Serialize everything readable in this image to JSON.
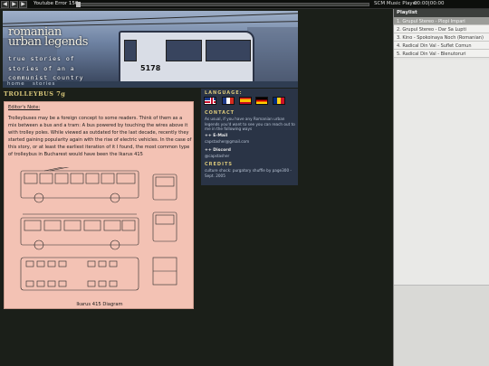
{
  "player": {
    "prev_icon": "◀",
    "play_icon": "▶",
    "next_icon": "▶",
    "status": "Youtube Error 150",
    "app_name": "SCM Music Player",
    "time": "00:00|00:00"
  },
  "header": {
    "title_line1": "romanian",
    "title_line2": "urban legends",
    "tagline": "true stories of\nstories of an a\ncommunist country",
    "bus_number": "5178",
    "nav": {
      "home": "home",
      "stories": "stories"
    }
  },
  "article": {
    "title": "TROLLEYBUS 7g",
    "editor_note": "Editor's Note:",
    "body": "Trolleybuses may be a foreign concept to some readers. Think of them as a mix between a bus and a tram: A bus powered by touching the wires above it with trolley poles. While viewed as outdated for the last decade, recently they started gaining popularity again with the rise of electric vehicles. In the case of this story, or at least the earliest iteration of it I found, the most common type of trolleybus in Bucharest would have been the Ikarus 415",
    "diagram_caption": "Ikarus 415 Diagram"
  },
  "info": {
    "language_heading": "LANGUAGE:",
    "contact_heading": "CONTACT",
    "contact_text": "As usual, if you have any Romanian urban legends you'd want to see you can reach out to me in the following ways",
    "email_label": "++ E-Mail",
    "email_value": "capstasher@gmail.com",
    "discord_label": "++ Discord",
    "discord_value": "@capstasher",
    "credits_heading": "CREDITS",
    "credits_text": "culture shock: purgatory shuffle by page300 - Sept. 2005"
  },
  "playlist": {
    "header": "Playlist",
    "items": [
      "1. Grupul Stereo - Plopi Impari",
      "2. Grupul Stereo - Dar Sa Lupti",
      "3. Kino - Spokoinaya Noch (Romanian)",
      "4. Radical Din Val - Suflet Comun",
      "5. Radical Din Val - Blenutoruri"
    ],
    "active_index": 0
  }
}
